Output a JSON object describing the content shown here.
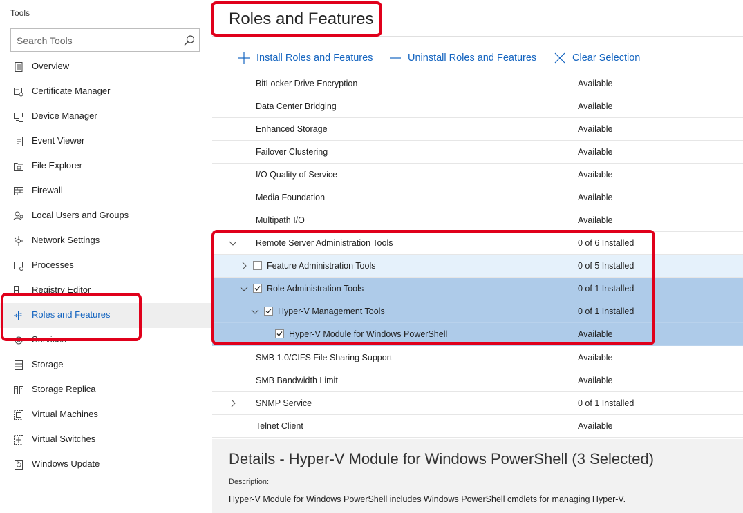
{
  "sidebar": {
    "title": "Tools",
    "search_placeholder": "Search Tools",
    "items": [
      {
        "label": "Overview",
        "icon": "list-icon"
      },
      {
        "label": "Certificate Manager",
        "icon": "certificate-icon"
      },
      {
        "label": "Device Manager",
        "icon": "device-icon"
      },
      {
        "label": "Event Viewer",
        "icon": "event-log-icon"
      },
      {
        "label": "File Explorer",
        "icon": "folder-icon"
      },
      {
        "label": "Firewall",
        "icon": "firewall-icon"
      },
      {
        "label": "Local Users and Groups",
        "icon": "users-icon"
      },
      {
        "label": "Network Settings",
        "icon": "network-icon"
      },
      {
        "label": "Processes",
        "icon": "process-icon"
      },
      {
        "label": "Registry Editor",
        "icon": "registry-icon"
      },
      {
        "label": "Roles and Features",
        "icon": "roles-icon"
      },
      {
        "label": "Services",
        "icon": "services-icon"
      },
      {
        "label": "Storage",
        "icon": "storage-icon"
      },
      {
        "label": "Storage Replica",
        "icon": "storage-replica-icon"
      },
      {
        "label": "Virtual Machines",
        "icon": "virtual-machine-icon"
      },
      {
        "label": "Virtual Switches",
        "icon": "virtual-switch-icon"
      },
      {
        "label": "Windows Update",
        "icon": "update-icon"
      }
    ]
  },
  "main": {
    "title": "Roles and Features",
    "commands": {
      "install": "Install Roles and Features",
      "uninstall": "Uninstall Roles and Features",
      "clear": "Clear Selection"
    },
    "features": [
      {
        "name": "BitLocker Drive Encryption",
        "state": "Available"
      },
      {
        "name": "Data Center Bridging",
        "state": "Available"
      },
      {
        "name": "Enhanced Storage",
        "state": "Available"
      },
      {
        "name": "Failover Clustering",
        "state": "Available"
      },
      {
        "name": "I/O Quality of Service",
        "state": "Available"
      },
      {
        "name": "Media Foundation",
        "state": "Available"
      },
      {
        "name": "Multipath I/O",
        "state": "Available"
      },
      {
        "name": "Remote Server Administration Tools",
        "state": "0 of 6 Installed"
      },
      {
        "name": "Feature Administration Tools",
        "state": "0 of 5 Installed"
      },
      {
        "name": "Role Administration Tools",
        "state": "0 of 1 Installed"
      },
      {
        "name": "Hyper-V Management Tools",
        "state": "0 of 1 Installed"
      },
      {
        "name": "Hyper-V Module for Windows PowerShell",
        "state": "Available"
      },
      {
        "name": "SMB 1.0/CIFS File Sharing Support",
        "state": "Available"
      },
      {
        "name": "SMB Bandwidth Limit",
        "state": "Available"
      },
      {
        "name": "SNMP Service",
        "state": "0 of 1 Installed"
      },
      {
        "name": "Telnet Client",
        "state": "Available"
      }
    ]
  },
  "details": {
    "title": "Details - Hyper-V Module for Windows PowerShell (3 Selected)",
    "description_label": "Description:",
    "description": "Hyper-V Module for Windows PowerShell includes Windows PowerShell cmdlets for managing Hyper-V."
  },
  "colors": {
    "accent": "#1565c0",
    "selected_row": "#aecbe9",
    "hover_row": "#e5f1fb",
    "annotation": "#e0001b"
  }
}
